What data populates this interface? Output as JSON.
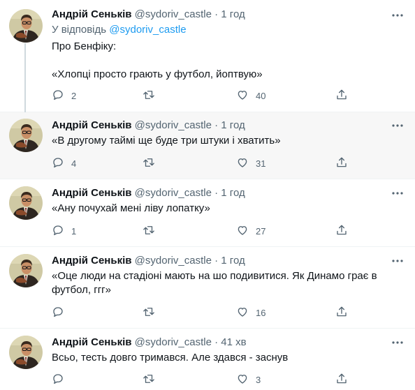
{
  "tweets": [
    {
      "name": "Андрій Сеньків",
      "handle": "@sydoriv_castle",
      "dot": "·",
      "time": "1 год",
      "reply_prefix": "У відповідь ",
      "reply_mention": "@sydoriv_castle",
      "text": "Про Бенфіку:\n\n«Хлопці просто грають у футбол, йоптвую»",
      "replies": "2",
      "retweets": "",
      "likes": "40"
    },
    {
      "name": "Андрій Сеньків",
      "handle": "@sydoriv_castle",
      "dot": "·",
      "time": "1 год",
      "text": "«В другому таймі ще буде три штуки і хватить»",
      "replies": "4",
      "retweets": "",
      "likes": "31"
    },
    {
      "name": "Андрій Сеньків",
      "handle": "@sydoriv_castle",
      "dot": "·",
      "time": "1 год",
      "text": "«Ану почухай мені ліву лопатку»",
      "replies": "1",
      "retweets": "",
      "likes": "27"
    },
    {
      "name": "Андрій Сеньків",
      "handle": "@sydoriv_castle",
      "dot": "·",
      "time": "1 год",
      "text": "«Оце люди на стадіоні мають на шо подивитися. Як Динамо грає в футбол, ггг»",
      "replies": "",
      "retweets": "",
      "likes": "16"
    },
    {
      "name": "Андрій Сеньків",
      "handle": "@sydoriv_castle",
      "dot": "·",
      "time": "41 хв",
      "text": "Всьо, тесть довго тримався. Але здався - заснув",
      "replies": "",
      "retweets": "",
      "likes": "3"
    }
  ],
  "icons": {
    "reply": "reply-icon",
    "retweet": "retweet-icon",
    "like": "heart-icon",
    "share": "share-icon",
    "more": "more-icon",
    "avatar": "avatar"
  },
  "colors": {
    "link": "#1d9bf0",
    "secondary": "#536471",
    "highlight_bg": "#f7f7f7",
    "thread_line": "#cfd9de"
  }
}
